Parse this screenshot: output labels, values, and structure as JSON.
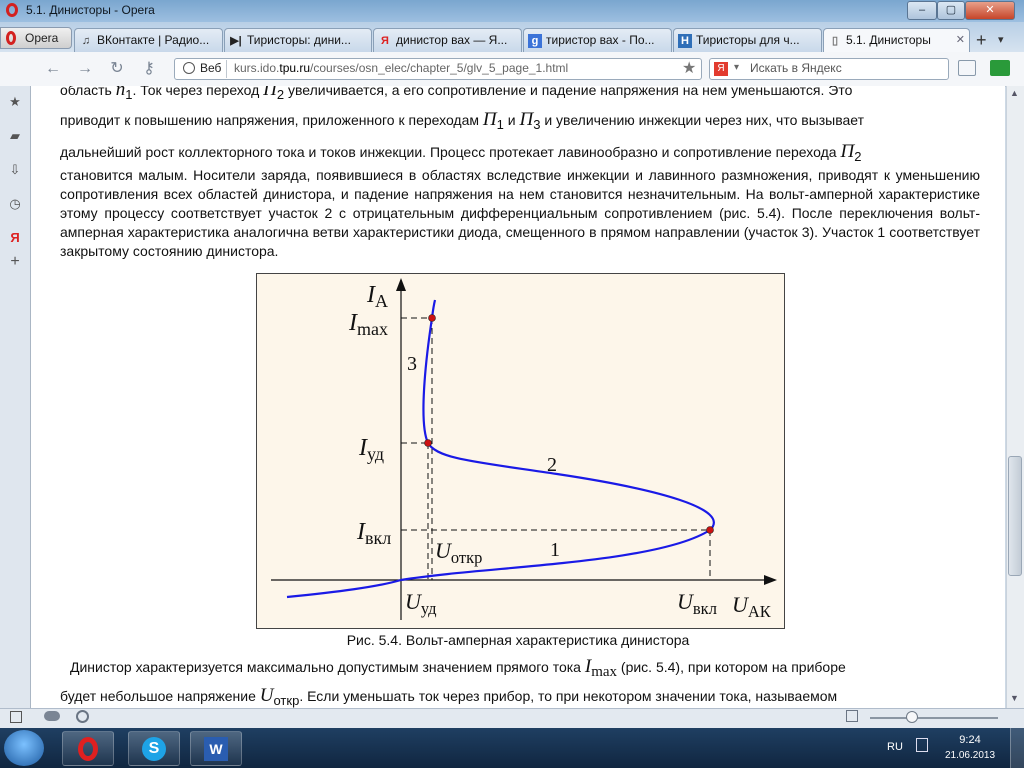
{
  "window": {
    "title": "5.1. Динисторы - Opera",
    "btn_min": "‒",
    "btn_max": "▢",
    "btn_close": "✕"
  },
  "opera_menu": {
    "label": "Opera"
  },
  "tabs": [
    {
      "label": "ВКонтакте | Радио...",
      "icon": "vk-icon"
    },
    {
      "label": "Тиристоры: дини...",
      "icon": "dinistor-icon"
    },
    {
      "label": "динистор вах — Я...",
      "icon": "yandex-icon"
    },
    {
      "label": "тиристор вах - По...",
      "icon": "google-icon"
    },
    {
      "label": "Тиристоры для ч...",
      "icon": "h-icon"
    },
    {
      "label": "5.1. Динисторы",
      "icon": "page-icon",
      "active": true
    }
  ],
  "address": {
    "web_label": "Веб",
    "url_prefix": "kurs.ido.",
    "url_domain": "tpu.ru",
    "url_path": "/courses/osn_elec/chapter_5/glv_5_page_1.html",
    "search_placeholder": "Искать в Яндекс",
    "search_brand": "Я"
  },
  "content": {
    "p1": {
      "l1_a": "область ",
      "l1_n": "n",
      "l1_n_sub": "1",
      "l1_b": ". Ток через переход ",
      "l1_P": "П",
      "l1_P_sub": "2",
      "l1_c": " увеличивается, а его сопротивление и падение напряжения на нем уменьшаются. Это",
      "l2_a": "приводит к повышению напряжения, приложенного к переходам ",
      "l2_P1": "П",
      "l2_P1_sub": "1",
      "l2_and": " и ",
      "l2_P3": "П",
      "l2_P3_sub": "3",
      "l2_b": " и увеличению инжекции через них, что вызывает",
      "l3_a": "дальнейший рост коллекторного тока и токов инжекции. Процесс протекает лавинообразно и сопротивление перехода ",
      "l3_P": "П",
      "l3_P_sub": "2",
      "rest": "становится малым. Носители заряда, появившиеся в областях вследствие инжекции и лавинного размножения, приводят к уменьшению сопротивления всех областей динистора, и падение напряжения на нем становится незначительным. На вольт-амперной характеристике этому процессу соответствует участок 2 с отрицательным дифференциальным сопротивлением (рис. 5.4). После переключения вольт-амперная характеристика аналогична ветви характеристики диода, смещенного в прямом направлении (участок 3). Участок 1 соответствует закрытому состоянию динистора."
    },
    "caption": "Рис. 5.4. Вольт-амперная характеристика динистора",
    "p2": {
      "l1_a": "Динистор характеризуется максимально допустимым значением прямого тока ",
      "l1_I": "I",
      "l1_I_sub": "max",
      "l1_b": " (рис. 5.4), при котором на приборе",
      "l2_a": "будет небольшое напряжение ",
      "l2_U": "U",
      "l2_U_sub": "откр",
      "l2_b": ". Если уменьшать ток через прибор, то при некотором значении тока, называемом"
    }
  },
  "chart_data": {
    "type": "line",
    "title": "",
    "xlabel": "U",
    "xlabel_sub": "АК",
    "ylabel": "I",
    "ylabel_sub": "А",
    "y_ticks": [
      {
        "label": "I",
        "sub": "max"
      },
      {
        "label": "I",
        "sub": "уд"
      },
      {
        "label": "I",
        "sub": "вкл"
      }
    ],
    "x_ticks": [
      {
        "label": "U",
        "sub": "уд"
      },
      {
        "label": "U",
        "sub": "вкл"
      }
    ],
    "extra_labels": [
      {
        "label": "U",
        "sub": "откр"
      }
    ],
    "segments": [
      "1",
      "2",
      "3"
    ],
    "curve_color": "#1a1ae6",
    "point_color": "#cc1111",
    "guide_style": "dashed"
  },
  "statusbar": {},
  "taskbar": {
    "lang": "RU",
    "time": "9:24",
    "date": "21.06.2013"
  }
}
